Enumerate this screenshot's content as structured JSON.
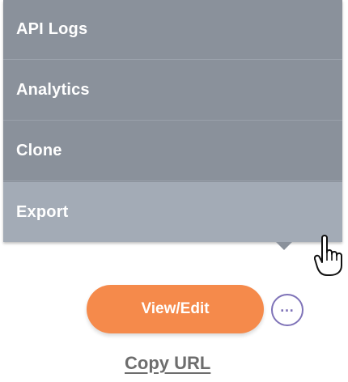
{
  "menu": {
    "items": [
      {
        "label": "API Logs"
      },
      {
        "label": "Analytics"
      },
      {
        "label": "Clone"
      },
      {
        "label": "Export"
      }
    ],
    "active_index": 3
  },
  "actions": {
    "view_edit_label": "View/Edit",
    "more_icon": "more-horizontal-icon",
    "copy_url_label": "Copy URL"
  },
  "colors": {
    "menu_bg": "#8a919b",
    "menu_active_bg": "#a3abb6",
    "primary_button": "#f58a4b",
    "more_button_accent": "#7f73b8",
    "link_text": "#6d6d6d"
  },
  "cursor": {
    "icon": "hand-pointer-icon"
  }
}
